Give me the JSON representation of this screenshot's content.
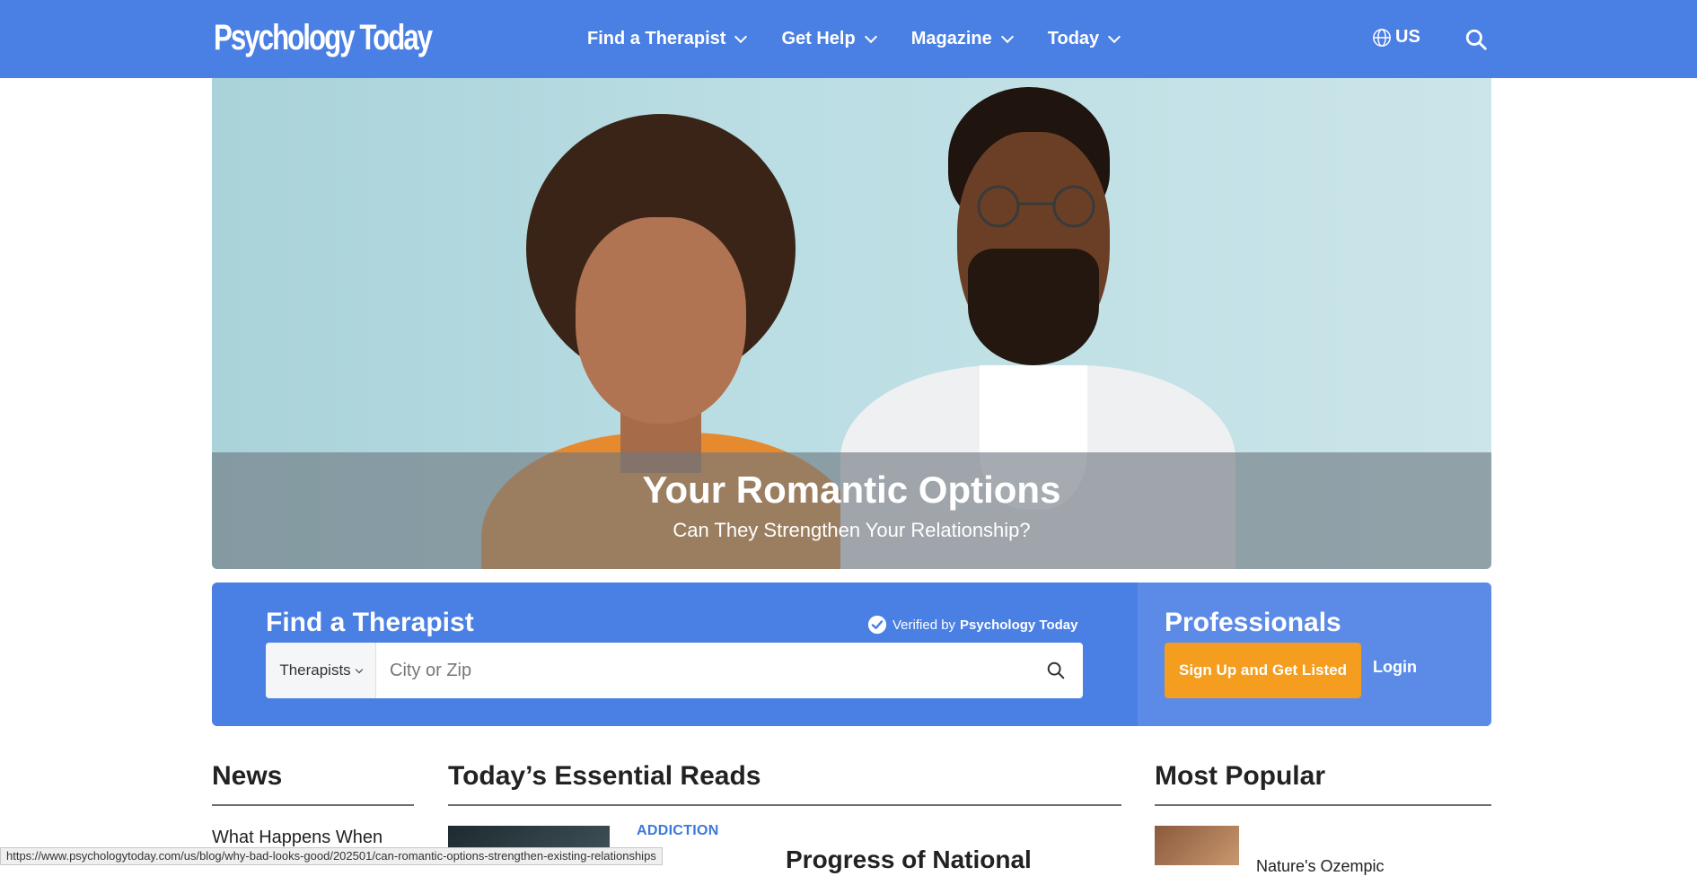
{
  "header": {
    "logo": "Psychology Today",
    "nav": [
      {
        "label": "Find a Therapist"
      },
      {
        "label": "Get Help"
      },
      {
        "label": "Magazine"
      },
      {
        "label": "Today"
      }
    ],
    "region": "US",
    "colors": {
      "primary": "#4a7fe4",
      "accent": "#f59d1e"
    }
  },
  "hero": {
    "title": "Your Romantic Options",
    "subtitle": "Can They Strengthen Your Relationship?"
  },
  "finder": {
    "title": "Find a Therapist",
    "verified_prefix": "Verified by",
    "verified_brand": "Psychology Today",
    "type_select": "Therapists",
    "city_placeholder": "City or Zip"
  },
  "professionals": {
    "title": "Professionals",
    "signup_label": "Sign Up and Get Listed",
    "login_label": "Login"
  },
  "sections": {
    "news": {
      "title": "News",
      "first_item": "What Happens When"
    },
    "essential_reads": {
      "title": "Today’s Essential Reads",
      "category": "ADDICTION",
      "first_title": "Progress of National"
    },
    "most_popular": {
      "title": "Most Popular",
      "first_title": "Nature's Ozempic"
    }
  },
  "status_bar": {
    "url": "https://www.psychologytoday.com/us/blog/why-bad-looks-good/202501/can-romantic-options-strengthen-existing-relationships"
  },
  "icons": [
    "chevron-down-icon",
    "globe-icon",
    "search-icon",
    "check-circle-icon"
  ]
}
